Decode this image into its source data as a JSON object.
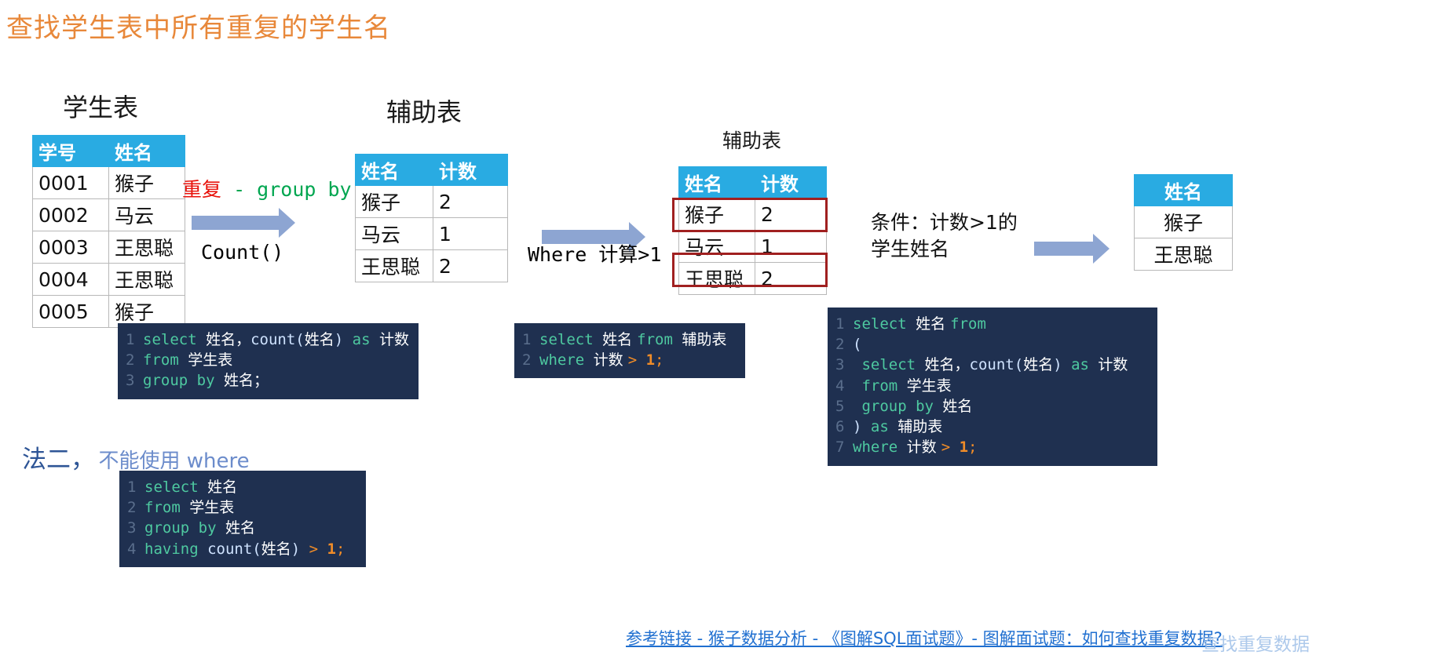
{
  "title": "查找学生表中所有重复的学生名",
  "title_color": "#E8883A",
  "accent_header_color": "#29ABE2",
  "arrow_color": "#8DA5D2",
  "highlight_color": "#A02020",
  "code_bg_color": "#1F3050",
  "tables": {
    "student": {
      "caption": "学生表",
      "headers": [
        "学号",
        "姓名"
      ],
      "rows": [
        [
          "0001",
          "猴子"
        ],
        [
          "0002",
          "马云"
        ],
        [
          "0003",
          "王思聪"
        ],
        [
          "0004",
          "王思聪"
        ],
        [
          "0005",
          "猴子"
        ]
      ]
    },
    "aux1": {
      "caption": "辅助表",
      "headers": [
        "姓名",
        "计数"
      ],
      "rows": [
        [
          "猴子",
          "2"
        ],
        [
          "马云",
          "1"
        ],
        [
          "王思聪",
          "2"
        ]
      ]
    },
    "aux2": {
      "caption": "辅助表",
      "headers": [
        "姓名",
        "计数"
      ],
      "rows": [
        [
          "猴子",
          "2"
        ],
        [
          "马云",
          "1"
        ],
        [
          "王思聪",
          "2"
        ]
      ],
      "highlighted_rows": [
        0,
        2
      ]
    },
    "result": {
      "caption": "",
      "headers": [
        "姓名"
      ],
      "rows": [
        [
          "猴子"
        ],
        [
          "王思聪"
        ]
      ]
    }
  },
  "annotations": {
    "arrow1_top_red": "重复",
    "arrow1_top_green": "- group by",
    "arrow1_bottom_green": "Count()",
    "arrow2_label": "Where 计算>1",
    "arrow3_line1": "条件：计数>1的",
    "arrow3_line2": "学生姓名"
  },
  "method2": {
    "prefix": "法二，",
    "suffix": "不能使用 where"
  },
  "code_blocks": {
    "block1": {
      "lines": [
        {
          "n": "1",
          "parts": [
            {
              "t": "select ",
              "c": "kw"
            },
            {
              "t": "姓名，",
              "c": "cn"
            },
            {
              "t": "count",
              "c": "fn"
            },
            {
              "t": "(",
              "c": "pn"
            },
            {
              "t": "姓名",
              "c": "cn"
            },
            {
              "t": ")",
              "c": "pn"
            },
            {
              "t": " as ",
              "c": "kw"
            },
            {
              "t": "计数",
              "c": "cn"
            }
          ]
        },
        {
          "n": "2",
          "parts": [
            {
              "t": "from ",
              "c": "kw"
            },
            {
              "t": "学生表",
              "c": "cn"
            }
          ]
        },
        {
          "n": "3",
          "parts": [
            {
              "t": "group by ",
              "c": "kw"
            },
            {
              "t": "姓名；",
              "c": "cn"
            }
          ]
        }
      ]
    },
    "block2": {
      "lines": [
        {
          "n": "1",
          "parts": [
            {
              "t": "select ",
              "c": "kw"
            },
            {
              "t": "姓名 ",
              "c": "cn"
            },
            {
              "t": "from ",
              "c": "kw"
            },
            {
              "t": "辅助表",
              "c": "cn"
            }
          ]
        },
        {
          "n": "2",
          "parts": [
            {
              "t": "where ",
              "c": "kw"
            },
            {
              "t": "计数 ",
              "c": "cn"
            },
            {
              "t": "> ",
              "c": "op"
            },
            {
              "t": "1",
              "c": "num"
            },
            {
              "t": ";",
              "c": "op"
            }
          ]
        }
      ]
    },
    "block3": {
      "lines": [
        {
          "n": "1",
          "parts": [
            {
              "t": "select ",
              "c": "kw"
            },
            {
              "t": "姓名 ",
              "c": "cn"
            },
            {
              "t": "from",
              "c": "kw"
            }
          ]
        },
        {
          "n": "2",
          "parts": [
            {
              "t": "(",
              "c": "pn"
            }
          ]
        },
        {
          "n": "3",
          "parts": [
            {
              "t": " select ",
              "c": "kw"
            },
            {
              "t": "姓名，",
              "c": "cn"
            },
            {
              "t": "count",
              "c": "fn"
            },
            {
              "t": "(",
              "c": "pn"
            },
            {
              "t": "姓名",
              "c": "cn"
            },
            {
              "t": ")",
              "c": "pn"
            },
            {
              "t": " as ",
              "c": "kw"
            },
            {
              "t": "计数",
              "c": "cn"
            }
          ]
        },
        {
          "n": "4",
          "parts": [
            {
              "t": " from ",
              "c": "kw"
            },
            {
              "t": "学生表",
              "c": "cn"
            }
          ]
        },
        {
          "n": "5",
          "parts": [
            {
              "t": " group by ",
              "c": "kw"
            },
            {
              "t": "姓名",
              "c": "cn"
            }
          ]
        },
        {
          "n": "6",
          "parts": [
            {
              "t": ") ",
              "c": "pn"
            },
            {
              "t": "as ",
              "c": "kw"
            },
            {
              "t": "辅助表",
              "c": "cn"
            }
          ]
        },
        {
          "n": "7",
          "parts": [
            {
              "t": "where ",
              "c": "kw"
            },
            {
              "t": "计数 ",
              "c": "cn"
            },
            {
              "t": "> ",
              "c": "op"
            },
            {
              "t": "1",
              "c": "num"
            },
            {
              "t": ";",
              "c": "op"
            }
          ]
        }
      ]
    },
    "block4": {
      "lines": [
        {
          "n": "1",
          "parts": [
            {
              "t": "select ",
              "c": "kw"
            },
            {
              "t": "姓名",
              "c": "cn"
            }
          ]
        },
        {
          "n": "2",
          "parts": [
            {
              "t": "from ",
              "c": "kw"
            },
            {
              "t": "学生表",
              "c": "cn"
            }
          ]
        },
        {
          "n": "3",
          "parts": [
            {
              "t": "group by ",
              "c": "kw"
            },
            {
              "t": "姓名",
              "c": "cn"
            }
          ]
        },
        {
          "n": "4",
          "parts": [
            {
              "t": "having ",
              "c": "kw"
            },
            {
              "t": "count",
              "c": "fn"
            },
            {
              "t": "(",
              "c": "pn"
            },
            {
              "t": "姓名",
              "c": "cn"
            },
            {
              "t": ")",
              "c": "pn"
            },
            {
              "t": " > ",
              "c": "op"
            },
            {
              "t": "1",
              "c": "num"
            },
            {
              "t": ";",
              "c": "op"
            }
          ]
        }
      ]
    }
  },
  "footer": {
    "reference_link": "参考链接 - 猴子数据分析 - 《图解SQL面试题》- 图解面试题：如何查找重复数据?",
    "watermark": "查找重复数据"
  }
}
